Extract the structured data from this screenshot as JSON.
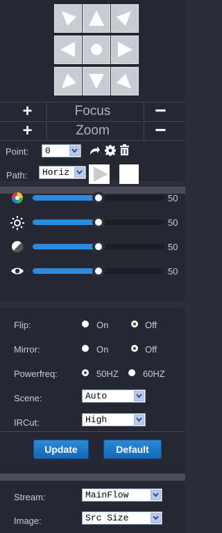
{
  "ptz": {
    "focus_label": "Focus",
    "zoom_label": "Zoom"
  },
  "point": {
    "label": "Point:",
    "value": "0"
  },
  "path": {
    "label": "Path:",
    "value": "Horiz"
  },
  "sliders": [
    {
      "name": "saturation",
      "icon": "color-wheel-icon",
      "value": "50",
      "percent": 50
    },
    {
      "name": "brightness",
      "icon": "sun-icon",
      "value": "50",
      "percent": 50
    },
    {
      "name": "contrast",
      "icon": "contrast-icon",
      "value": "50",
      "percent": 50
    },
    {
      "name": "sharpness",
      "icon": "eye-icon",
      "value": "50",
      "percent": 50
    }
  ],
  "settings": {
    "flip": {
      "label": "Flip:",
      "on": "On",
      "off": "Off",
      "selected": "Off"
    },
    "mirror": {
      "label": "Mirror:",
      "on": "On",
      "off": "Off",
      "selected": "Off"
    },
    "powerfreq": {
      "label": "Powerfreq:",
      "opt1": "50HZ",
      "opt2": "60HZ",
      "selected": "50HZ"
    },
    "scene": {
      "label": "Scene:",
      "value": "Auto"
    },
    "ircut": {
      "label": "IRCut:",
      "value": "High"
    }
  },
  "buttons": {
    "update": "Update",
    "default": "Default"
  },
  "stream": {
    "label": "Stream:",
    "value": "MainFlow"
  },
  "image": {
    "label": "Image:",
    "value": "Src Size"
  },
  "colors": {
    "accent": "#2a8ce0",
    "panel": "#252832",
    "separator": "#4a4e5a"
  }
}
